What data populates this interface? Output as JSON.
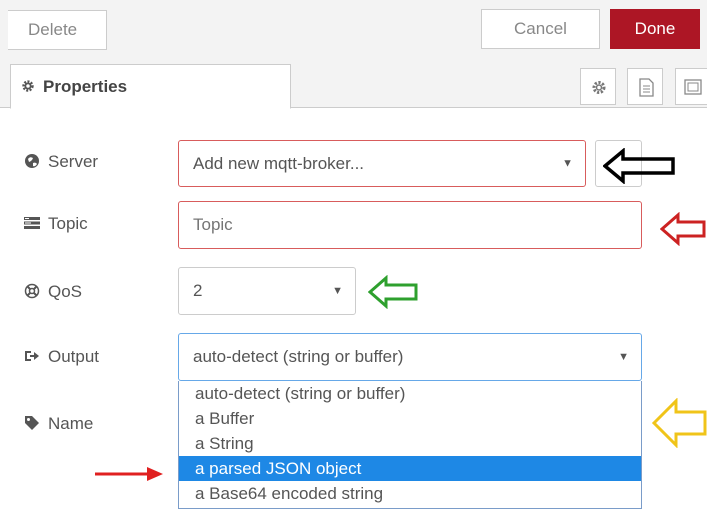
{
  "toolbar": {
    "delete_label": "Delete",
    "cancel_label": "Cancel",
    "done_label": "Done"
  },
  "tabs": {
    "properties_label": "Properties"
  },
  "form": {
    "server": {
      "label": "Server",
      "value": "Add new mqtt-broker..."
    },
    "topic": {
      "label": "Topic",
      "placeholder": "Topic"
    },
    "qos": {
      "label": "QoS",
      "value": "2"
    },
    "output": {
      "label": "Output",
      "value": "auto-detect (string or buffer)"
    },
    "name": {
      "label": "Name"
    }
  },
  "output_options": [
    {
      "label": "auto-detect (string or buffer)"
    },
    {
      "label": "a Buffer"
    },
    {
      "label": "a String"
    },
    {
      "label": "a parsed JSON object"
    },
    {
      "label": "a Base64 encoded string"
    }
  ],
  "colors": {
    "done_button": "#ad1625",
    "invalid_border": "#d85c5c",
    "selected_option": "#1e88e5",
    "arrow_black": "#000000",
    "arrow_red": "#cc2222",
    "arrow_green": "#2ea02e",
    "arrow_yellow": "#f0c419",
    "pointer_red": "#e02020"
  }
}
